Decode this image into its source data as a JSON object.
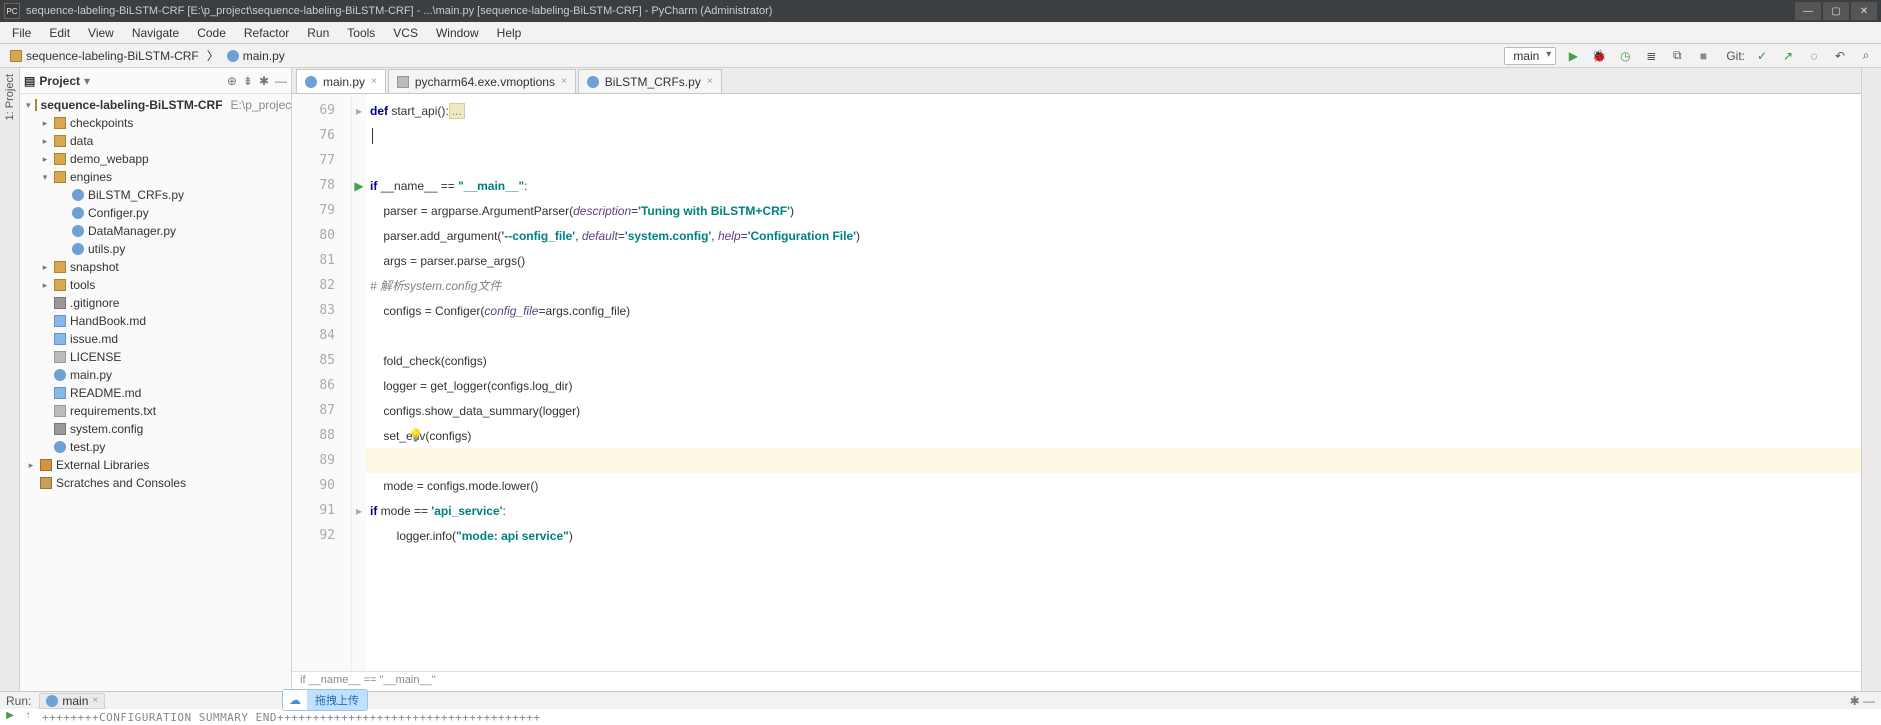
{
  "window": {
    "title": "sequence-labeling-BiLSTM-CRF [E:\\p_project\\sequence-labeling-BiLSTM-CRF] - ...\\main.py [sequence-labeling-BiLSTM-CRF] - PyCharm (Administrator)",
    "app_badge": "PC"
  },
  "menu": [
    "File",
    "Edit",
    "View",
    "Navigate",
    "Code",
    "Refactor",
    "Run",
    "Tools",
    "VCS",
    "Window",
    "Help"
  ],
  "breadcrumbs": {
    "project": "sequence-labeling-BiLSTM-CRF",
    "file": "main.py"
  },
  "run_config": {
    "selected": "main"
  },
  "git_label": "Git:",
  "left_tab": "1: Project",
  "project_panel": {
    "title": "Project",
    "root": {
      "name": "sequence-labeling-BiLSTM-CRF",
      "path": "E:\\p_project\\se"
    },
    "tree": [
      {
        "type": "folder",
        "name": "checkpoints",
        "indent": 1,
        "closed": true
      },
      {
        "type": "folder",
        "name": "data",
        "indent": 1,
        "closed": true
      },
      {
        "type": "folder",
        "name": "demo_webapp",
        "indent": 1,
        "closed": true
      },
      {
        "type": "folder",
        "name": "engines",
        "indent": 1,
        "closed": false
      },
      {
        "type": "py",
        "name": "BiLSTM_CRFs.py",
        "indent": 2
      },
      {
        "type": "py",
        "name": "Configer.py",
        "indent": 2
      },
      {
        "type": "py",
        "name": "DataManager.py",
        "indent": 2
      },
      {
        "type": "py",
        "name": "utils.py",
        "indent": 2
      },
      {
        "type": "folder",
        "name": "snapshot",
        "indent": 1,
        "closed": true
      },
      {
        "type": "folder",
        "name": "tools",
        "indent": 1,
        "closed": true
      },
      {
        "type": "git",
        "name": ".gitignore",
        "indent": 1
      },
      {
        "type": "md",
        "name": "HandBook.md",
        "indent": 1
      },
      {
        "type": "md",
        "name": "issue.md",
        "indent": 1
      },
      {
        "type": "txt",
        "name": "LICENSE",
        "indent": 1
      },
      {
        "type": "py",
        "name": "main.py",
        "indent": 1
      },
      {
        "type": "md",
        "name": "README.md",
        "indent": 1
      },
      {
        "type": "txt",
        "name": "requirements.txt",
        "indent": 1
      },
      {
        "type": "cfg",
        "name": "system.config",
        "indent": 1
      },
      {
        "type": "py",
        "name": "test.py",
        "indent": 1
      }
    ],
    "ext_libs": "External Libraries",
    "scratches": "Scratches and Consoles"
  },
  "tabs": [
    {
      "label": "main.py",
      "active": true,
      "kind": "py"
    },
    {
      "label": "pycharm64.exe.vmoptions",
      "active": false,
      "kind": "vm"
    },
    {
      "label": "BiLSTM_CRFs.py",
      "active": false,
      "kind": "py"
    }
  ],
  "editor": {
    "lines": [
      {
        "n": 69,
        "html": "<span class='kw'>def</span> start_api():<span class='ellipsis'>...</span>",
        "fold": "▸"
      },
      {
        "n": 76,
        "html": "    <span class='caret text-caret'></span>"
      },
      {
        "n": 77,
        "html": ""
      },
      {
        "n": 78,
        "html": "<span class='kw'>if</span> __name__ == <span class='str'>\"__main__\"</span>:",
        "run": "▶"
      },
      {
        "n": 79,
        "html": "    parser = argparse.ArgumentParser(<span class='param'>description</span>=<span class='str'>'Tuning with BiLSTM+CRF'</span>)"
      },
      {
        "n": 80,
        "html": "    parser.add_argument(<span class='str'>'--config_file'</span>, <span class='param'>default</span>=<span class='str'>'system.config'</span>, <span class='param'>help</span>=<span class='str'>'Configuration File'</span>)"
      },
      {
        "n": 81,
        "html": "    args = parser.parse_args()"
      },
      {
        "n": 82,
        "html": "    <span class='cmt'># 解析system.config文件</span>"
      },
      {
        "n": 83,
        "html": "    configs = Configer(<span class='param'>config_file</span>=args.config_file)"
      },
      {
        "n": 84,
        "html": ""
      },
      {
        "n": 85,
        "html": "    fold_check(configs)"
      },
      {
        "n": 86,
        "html": "    logger = get_logger(configs.log_dir)"
      },
      {
        "n": 87,
        "html": "    configs.show_data_summary(logger)"
      },
      {
        "n": 88,
        "html": "    set_env(configs)",
        "bulb": true
      },
      {
        "n": 89,
        "html": "",
        "hl": true
      },
      {
        "n": 90,
        "html": "    mode = configs.mode.lower()"
      },
      {
        "n": 91,
        "html": "    <span class='kw'>if</span> mode == <span class='str'>'api_service'</span>:",
        "fold": "▸"
      },
      {
        "n": 92,
        "html": "        logger.info(<span class='str'>\"mode: api service\"</span>)"
      }
    ],
    "bottom_breadcrumb": "if __name__ == \"__main__\""
  },
  "run_tool": {
    "label": "Run:",
    "config": "main"
  },
  "console_line": "++++++++CONFIGURATION SUMMARY END+++++++++++++++++++++++++++++++++++++",
  "cloud_pill": "拖拽上传"
}
